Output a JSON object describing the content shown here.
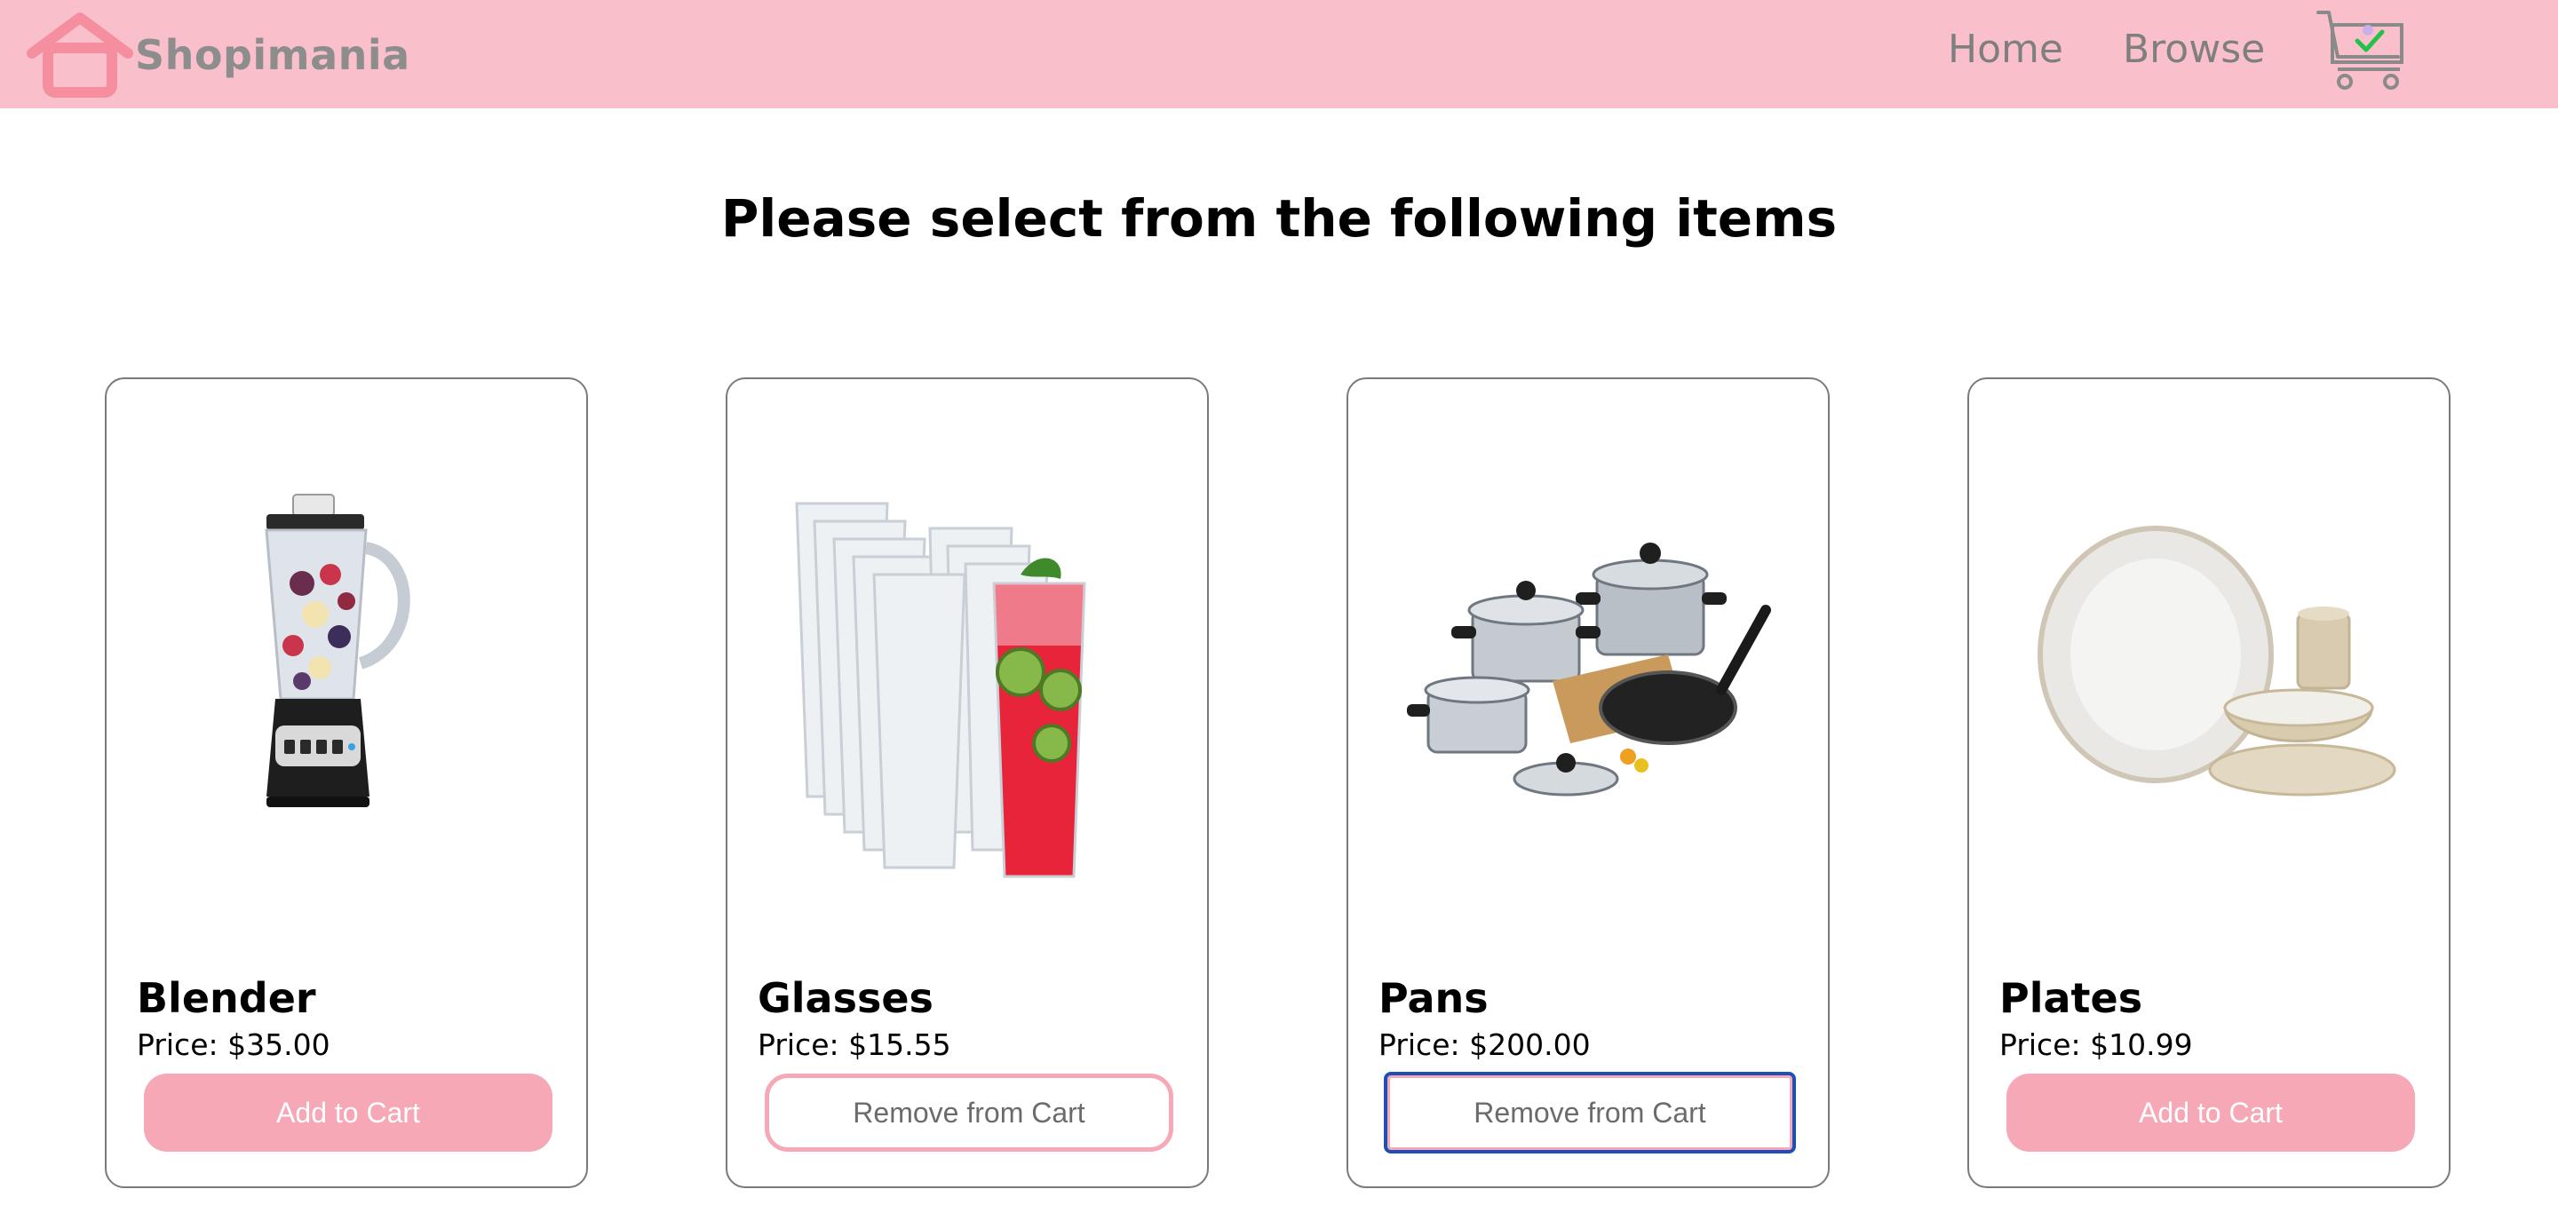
{
  "nav": {
    "brand": "Shopimania",
    "links": [
      "Home",
      "Browse"
    ]
  },
  "colors": {
    "navbar_bg": "#f9c0cb",
    "button_pink": "#f7a8b7",
    "focus_outline": "#1f4fb5",
    "nav_text": "#7f7f7f"
  },
  "icons": {
    "logo": "house-outline-icon",
    "cart": "shopping-cart-check-icon"
  },
  "page": {
    "title": "Please select from the following items"
  },
  "products": [
    {
      "name": "Blender",
      "price": "Price: $35.00",
      "button": "Add to Cart",
      "image": "blender-image"
    },
    {
      "name": "Glasses",
      "price": "Price: $15.55",
      "button": "Remove from Cart",
      "image": "glasses-image"
    },
    {
      "name": "Pans",
      "price": "Price: $200.00",
      "button": "Remove from Cart",
      "image": "pans-image"
    },
    {
      "name": "Plates",
      "price": "Price: $10.99",
      "button": "Add to Cart",
      "image": "plates-image"
    }
  ]
}
